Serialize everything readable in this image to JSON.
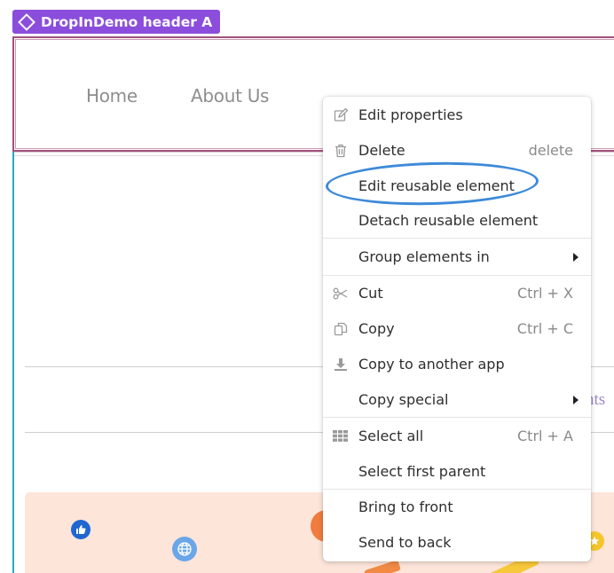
{
  "element_tag": {
    "label": "DropInDemo header A",
    "icon": "diamond-icon"
  },
  "header_nav": {
    "links": [
      "Home",
      "About Us"
    ]
  },
  "peek_text": "nts",
  "hero_icons": [
    "like-icon",
    "globe-icon",
    "star-icon"
  ],
  "context_menu": {
    "items": [
      {
        "label": "Edit properties",
        "shortcut": "",
        "icon": "pencil-icon",
        "submenu": false
      },
      {
        "label": "Delete",
        "shortcut": "delete",
        "icon": "trash-icon",
        "submenu": false
      },
      {
        "label": "Edit reusable element",
        "shortcut": "",
        "icon": "",
        "submenu": false,
        "highlighted": true
      },
      {
        "label": "Detach reusable element",
        "shortcut": "",
        "icon": "",
        "submenu": false
      },
      {
        "label": "Group elements in",
        "shortcut": "",
        "icon": "",
        "submenu": true
      },
      {
        "label": "Cut",
        "shortcut": "Ctrl + X",
        "icon": "scissors-icon",
        "submenu": false
      },
      {
        "label": "Copy",
        "shortcut": "Ctrl + C",
        "icon": "copy-icon",
        "submenu": false
      },
      {
        "label": "Copy to another app",
        "shortcut": "",
        "icon": "download-icon",
        "submenu": false
      },
      {
        "label": "Copy special",
        "shortcut": "",
        "icon": "",
        "submenu": true
      },
      {
        "label": "Select all",
        "shortcut": "Ctrl + A",
        "icon": "grid-icon",
        "submenu": false
      },
      {
        "label": "Select first parent",
        "shortcut": "",
        "icon": "",
        "submenu": false
      },
      {
        "label": "Bring to front",
        "shortcut": "",
        "icon": "",
        "submenu": false
      },
      {
        "label": "Send to back",
        "shortcut": "",
        "icon": "",
        "submenu": false
      }
    ]
  },
  "colors": {
    "tag_purple": "#8b4ddb",
    "selection_outline": "#a1517a",
    "highlight_ellipse": "#3d8ad8",
    "hero_background": "#fde5da"
  }
}
